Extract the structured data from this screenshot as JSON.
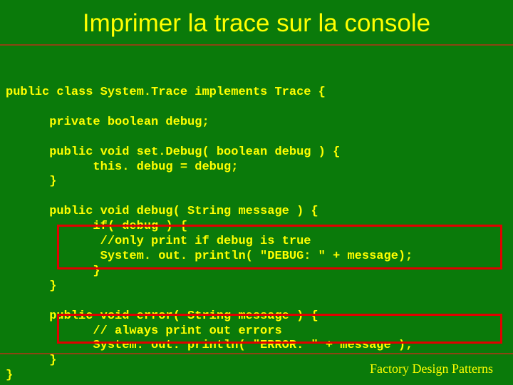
{
  "slide": {
    "title": "Imprimer la trace sur la console",
    "footer": "Factory Design Patterns"
  },
  "code": {
    "line1": "public class System.Trace implements Trace {",
    "line2": "      private boolean debug;",
    "line3": "      public void set.Debug( boolean debug ) {",
    "line4": "            this. debug = debug;",
    "line5": "      }",
    "line6": "      public void debug( String message ) {",
    "line7": "            if( debug ) {",
    "line8": "             //only print if debug is true",
    "line9": "             System. out. println( \"DEBUG: \" + message);",
    "line10": "            }",
    "line11": "      }",
    "line12": "      public void error( String message ) {",
    "line13": "            // always print out errors",
    "line14": "            System. out. println( \"ERROR: \" + message );",
    "line15": "      }",
    "line16": "}"
  }
}
